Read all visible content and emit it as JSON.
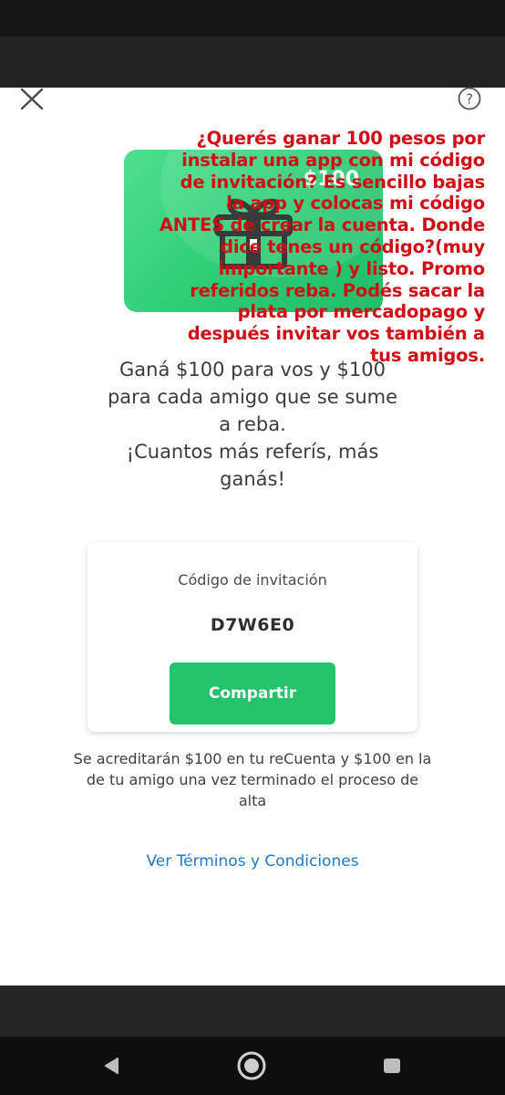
{
  "header": {
    "close_icon": "close-icon",
    "help_icon": "question-circle-icon"
  },
  "gift_card": {
    "amount": "$100",
    "icon": "gift-icon",
    "colors": {
      "card_start": "#4fe08f",
      "card_end": "#22bd6a"
    }
  },
  "overlay": {
    "text": "¿Querés ganar 100 pesos por instalar una app con mi código de invitación? Es sencillo bajas la app y colocas mi código ANTES de crear la cuenta. Donde dice tenes un código?(muy importante ) y listo. Promo referidos reba. Podés sacar la plata por mercadopago y después invitar vos también a tus amigos.",
    "color": "#d20d16"
  },
  "main": {
    "headline_line1": "Ganá $100 para vos y $100",
    "headline_line2": "para cada amigo que se sume",
    "headline_line3": "a reba.",
    "headline_line4": "¡Cuantos más referís, más",
    "headline_line5": "ganás!"
  },
  "invite": {
    "label": "Código de invitación",
    "code": "D7W6E0",
    "share_label": "Compartir",
    "accent": "#25c26c"
  },
  "info": {
    "text": "Se acreditarán $100 en tu reCuenta y $100 en la de tu amigo una vez terminado el proceso de alta"
  },
  "terms": {
    "label": "Ver Términos y Condiciones",
    "color": "#1f7ac4"
  },
  "navbar": {
    "back_icon": "back-triangle-icon",
    "home_icon": "home-circle-icon",
    "recents_icon": "recents-square-icon"
  }
}
